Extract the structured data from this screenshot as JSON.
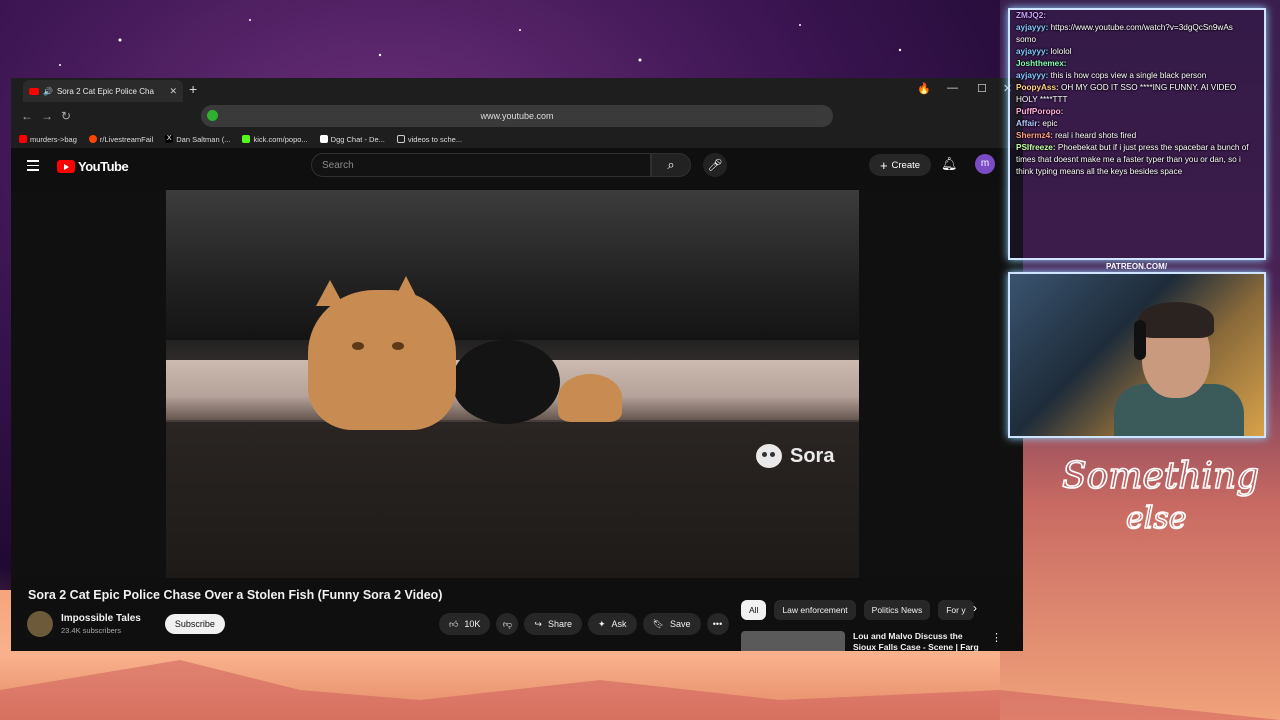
{
  "browser": {
    "tab_title": "Sora 2 Cat Epic Police Cha",
    "url": "www.youtube.com",
    "bookmarks": [
      "murders->bag",
      "r/LivestreamFail",
      "Dan Saltman (...",
      "kick.com/popo...",
      "Dgg Chat - De...",
      "videos to sche..."
    ]
  },
  "youtube": {
    "logo_text": "YouTube",
    "search_placeholder": "Search",
    "create_label": "Create",
    "avatar_letter": "m",
    "video_watermark": "Sora",
    "video_title": "Sora 2 Cat Epic Police Chase Over a Stolen Fish (Funny Sora 2 Video)",
    "channel_name": "Impossible Tales",
    "channel_subs": "23.4K subscribers",
    "subscribe_label": "Subscribe",
    "like_count": "10K",
    "share_label": "Share",
    "ask_label": "Ask",
    "save_label": "Save",
    "chips": [
      "All",
      "Law enforcement",
      "Politics News",
      "For y"
    ],
    "recommendation_title": "Lou and Malvo Discuss the Sioux Falls Case - Scene | Farg"
  },
  "chat": {
    "lines": [
      {
        "user": "ZMJQ2:",
        "text": ""
      },
      {
        "user": "ayjayyy:",
        "text": "https://www.youtube.com/watch?v=3dgQcSn9wAs"
      },
      {
        "user": "",
        "text": "somo"
      },
      {
        "user": "ayjayyy:",
        "text": "lololol"
      },
      {
        "user": "Joshthemex:",
        "text": ""
      },
      {
        "user": "ayjayyy:",
        "text": "this is how cops view a single black person"
      },
      {
        "user": "PoopyAss:",
        "text": "OH MY GOD IT SSO ****ING FUNNY. AI VIDEO HOLY ****TTT"
      },
      {
        "user": "PuffPoropo:",
        "text": ""
      },
      {
        "user": "Affair:",
        "text": "epic"
      },
      {
        "user": "Shermz4:",
        "text": "real i heard shots fired"
      },
      {
        "user": "PSIfreeze:",
        "text": "Phoebekat but if i just press the spacebar a bunch of times that doesnt make me a faster typer than you or dan, so i think typing means all the keys besides space"
      }
    ],
    "patreon_label": "PATREON.COM/"
  },
  "overlay": {
    "script_text_1": "Something",
    "script_text_2": "else"
  }
}
